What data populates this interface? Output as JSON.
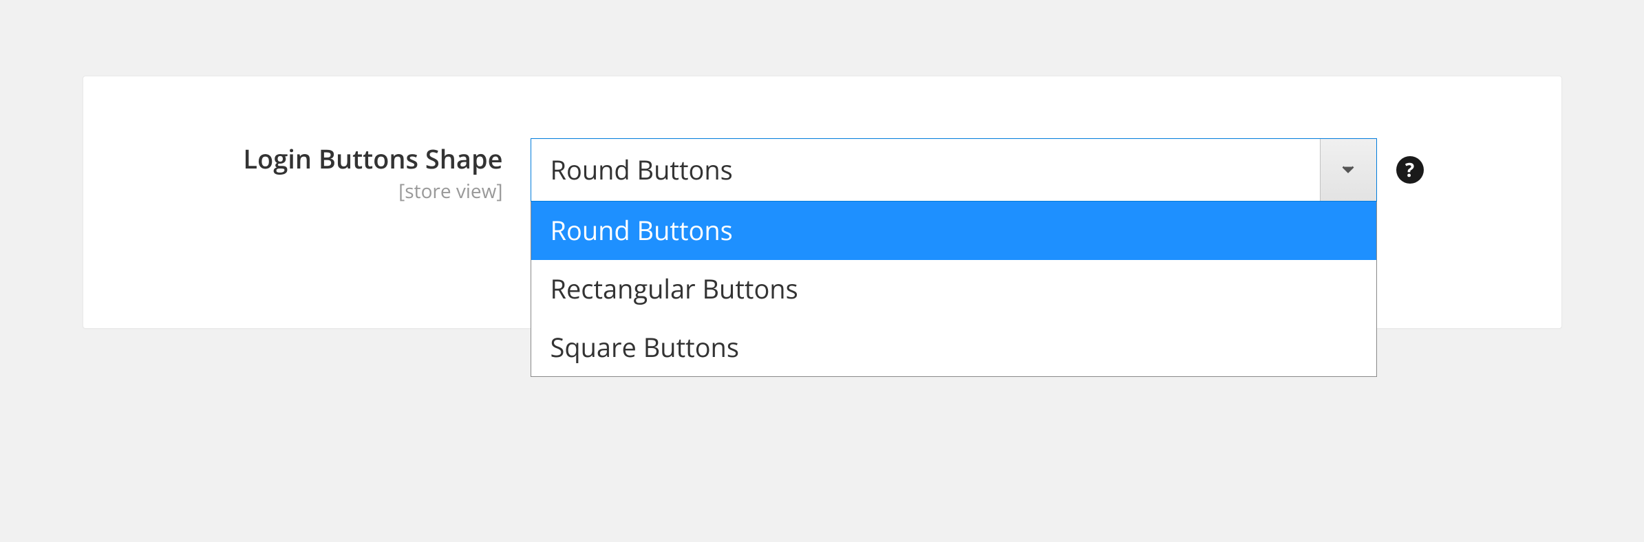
{
  "field": {
    "label": "Login Buttons Shape",
    "scope": "[store view]",
    "selected": "Round Buttons",
    "options": [
      "Round Buttons",
      "Rectangular Buttons",
      "Square Buttons"
    ],
    "selectedIndex": 0
  },
  "help": {
    "symbol": "?"
  }
}
